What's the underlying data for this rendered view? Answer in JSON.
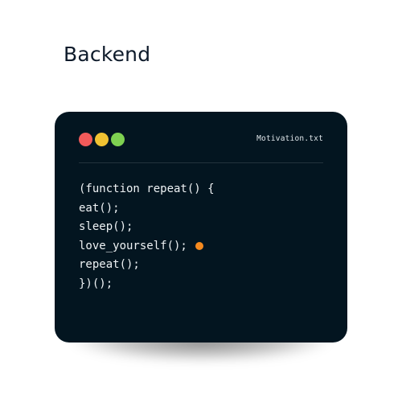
{
  "heading": "Backend",
  "colors": {
    "page_background": "#ffffff",
    "heading_text": "#0e1b2b",
    "window_background": "#031520",
    "code_text": "#eef2f4",
    "divider": "#22323c",
    "red_dot": "#f25a5a",
    "yellow_dot": "#f1c232",
    "green_dot": "#7ed151",
    "marker_dot": "#f58a1f"
  },
  "window": {
    "filename": "Motivation.txt",
    "controls": [
      {
        "name": "close-dot-icon",
        "color": "#f25a5a"
      },
      {
        "name": "minimize-dot-icon",
        "color": "#f1c232"
      },
      {
        "name": "maximize-dot-icon",
        "color": "#7ed151"
      }
    ],
    "code_lines": [
      "(function repeat() {",
      "eat();",
      "sleep();",
      "love_yourself();",
      "repeat();",
      "})();"
    ],
    "marker_line_index": 3,
    "marker_icon": "orange-dot-icon"
  }
}
